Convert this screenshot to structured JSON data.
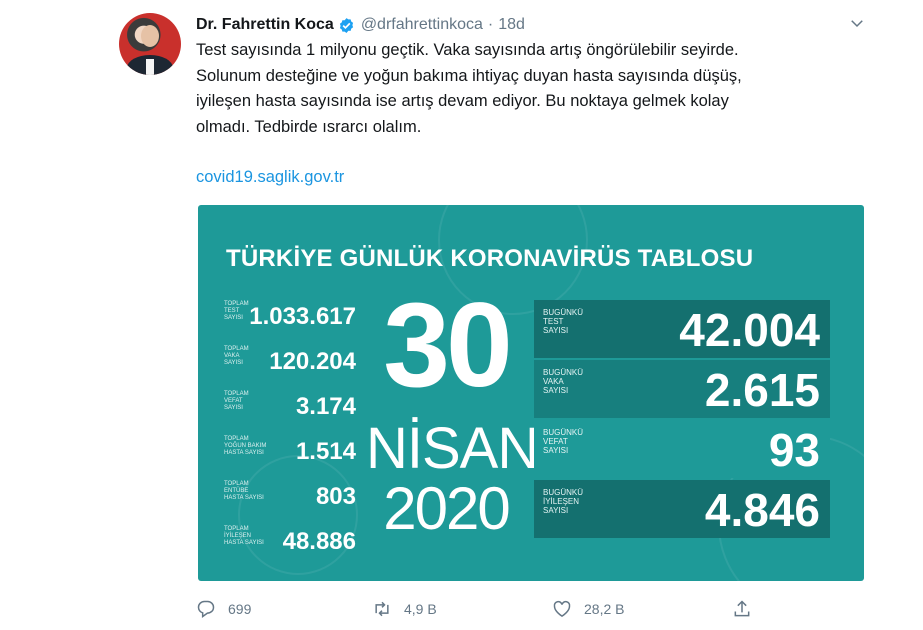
{
  "tweet": {
    "author_name": "Dr. Fahrettin Koca",
    "handle": "@drfahrettinkoca",
    "separator": "·",
    "time": "18d",
    "text_lines": [
      "Test sayısında 1 milyonu geçtik. Vaka sayısında artış öngörülebilir seyirde.",
      "Solunum desteğine ve yoğun bakıma ihtiyaç duyan hasta sayısında düşüş,",
      "iyileşen hasta sayısında ise artış devam ediyor. Bu noktaya gelmek kolay",
      "olmadı. Tedbirde ısrarcı olalım."
    ],
    "link": "covid19.saglik.gov.tr"
  },
  "card": {
    "title": "TÜRKİYE GÜNLÜK KORONAVİRÜS TABLOSU",
    "date": {
      "day": "30",
      "month": "NİSAN",
      "year": "2020"
    },
    "left_stats": [
      {
        "label_lines": [
          "TOPLAM",
          "TEST",
          "SAYISI"
        ],
        "value": "1.033.617"
      },
      {
        "label_lines": [
          "TOPLAM",
          "VAKA",
          "SAYISI"
        ],
        "value": "120.204"
      },
      {
        "label_lines": [
          "TOPLAM",
          "VEFAT",
          "SAYISI"
        ],
        "value": "3.174"
      },
      {
        "label_lines": [
          "TOPLAM",
          "YOĞUN BAKIM",
          "HASTA SAYISI"
        ],
        "value": "1.514"
      },
      {
        "label_lines": [
          "TOPLAM",
          "ENTÜBE",
          "HASTA SAYISI"
        ],
        "value": "803"
      },
      {
        "label_lines": [
          "TOPLAM",
          "İYİLEŞEN",
          "HASTA SAYISI"
        ],
        "value": "48.886"
      }
    ],
    "right_stats": [
      {
        "label_lines": [
          "BUGÜNKÜ",
          "TEST",
          "SAYISI"
        ],
        "value": "42.004"
      },
      {
        "label_lines": [
          "BUGÜNKÜ",
          "VAKA",
          "SAYISI"
        ],
        "value": "2.615"
      },
      {
        "label_lines": [
          "BUGÜNKÜ",
          "VEFAT",
          "SAYISI"
        ],
        "value": "93"
      },
      {
        "label_lines": [
          "BUGÜNKÜ",
          "İYİLEŞEN",
          "SAYISI"
        ],
        "value": "4.846"
      }
    ],
    "colors": {
      "background": "#1e9a98",
      "box": "#177f7e",
      "box_dark": "#14706f"
    }
  },
  "actions": {
    "reply": {
      "icon": "reply-icon",
      "count": "699"
    },
    "retweet": {
      "icon": "retweet-icon",
      "count": "4,9 B"
    },
    "like": {
      "icon": "heart-icon",
      "count": "28,2 B"
    },
    "share": {
      "icon": "share-icon"
    }
  },
  "colors": {
    "link": "#1b95e0",
    "verified": "#1da1f2",
    "muted": "#657786"
  }
}
